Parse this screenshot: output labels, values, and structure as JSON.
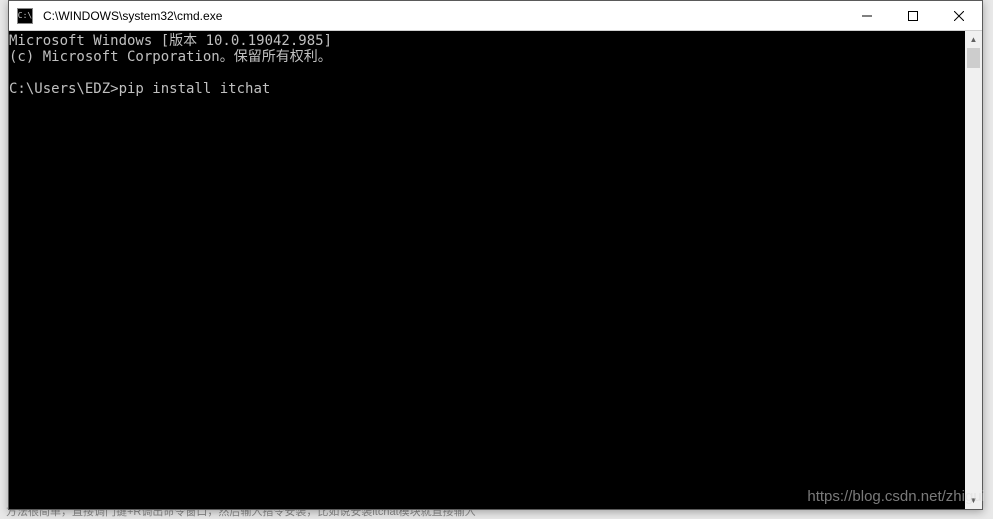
{
  "window": {
    "title": "C:\\WINDOWS\\system32\\cmd.exe",
    "icon_glyph": "C:\\"
  },
  "console": {
    "line1": "Microsoft Windows [版本 10.0.19042.985]",
    "line2": "(c) Microsoft Corporation。保留所有权利。",
    "blank": "",
    "prompt": "C:\\Users\\EDZ>",
    "command": "pip install itchat"
  },
  "watermark": "https://blog.csdn.net/zhigui",
  "background_hint": "方法很简单，直接调门键+R调出命令窗口，然后输入指令安装，比如说安装itchat模块就直接输入"
}
